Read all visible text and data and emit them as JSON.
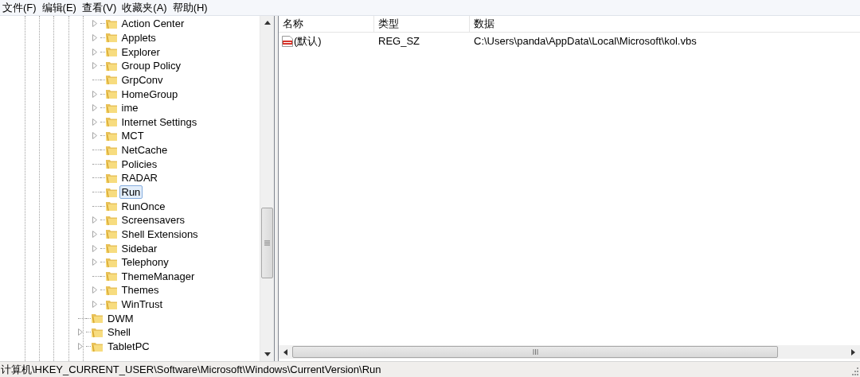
{
  "menu": [
    "文件(F)",
    "编辑(E)",
    "查看(V)",
    "收藏夹(A)",
    "帮助(H)"
  ],
  "tree": {
    "items": [
      {
        "children": [
          {
            "label": "Action Center",
            "expandable": true,
            "selected": false
          },
          {
            "label": "Applets",
            "expandable": true,
            "selected": false
          },
          {
            "label": "Explorer",
            "expandable": true,
            "selected": false
          },
          {
            "label": "Group Policy",
            "expandable": true,
            "selected": false
          },
          {
            "label": "GrpConv",
            "expandable": false,
            "selected": false
          },
          {
            "label": "HomeGroup",
            "expandable": true,
            "selected": false
          },
          {
            "label": "ime",
            "expandable": true,
            "selected": false
          },
          {
            "label": "Internet Settings",
            "expandable": true,
            "selected": false
          },
          {
            "label": "MCT",
            "expandable": true,
            "selected": false
          },
          {
            "label": "NetCache",
            "expandable": false,
            "selected": false
          },
          {
            "label": "Policies",
            "expandable": false,
            "selected": false
          },
          {
            "label": "RADAR",
            "expandable": false,
            "selected": false
          },
          {
            "label": "Run",
            "expandable": false,
            "selected": true
          },
          {
            "label": "RunOnce",
            "expandable": false,
            "selected": false
          },
          {
            "label": "Screensavers",
            "expandable": true,
            "selected": false
          },
          {
            "label": "Shell Extensions",
            "expandable": true,
            "selected": false
          },
          {
            "label": "Sidebar",
            "expandable": true,
            "selected": false
          },
          {
            "label": "Telephony",
            "expandable": true,
            "selected": false
          },
          {
            "label": "ThemeManager",
            "expandable": false,
            "selected": false
          },
          {
            "label": "Themes",
            "expandable": true,
            "selected": false
          },
          {
            "label": "WinTrust",
            "expandable": true,
            "selected": false
          }
        ]
      },
      {
        "label": "DWM",
        "expandable": false,
        "selected": false
      },
      {
        "label": "Shell",
        "expandable": true,
        "selected": false
      },
      {
        "label": "TabletPC",
        "expandable": true,
        "selected": false
      }
    ]
  },
  "list": {
    "columns": [
      "名称",
      "类型",
      "数据"
    ],
    "rows": [
      {
        "name": "(默认)",
        "type": "REG_SZ",
        "data": "C:\\Users\\panda\\AppData\\Local\\Microsoft\\kol.vbs",
        "selected": false
      }
    ]
  },
  "status_bar": "计算机\\HKEY_CURRENT_USER\\Software\\Microsoft\\Windows\\CurrentVersion\\Run"
}
